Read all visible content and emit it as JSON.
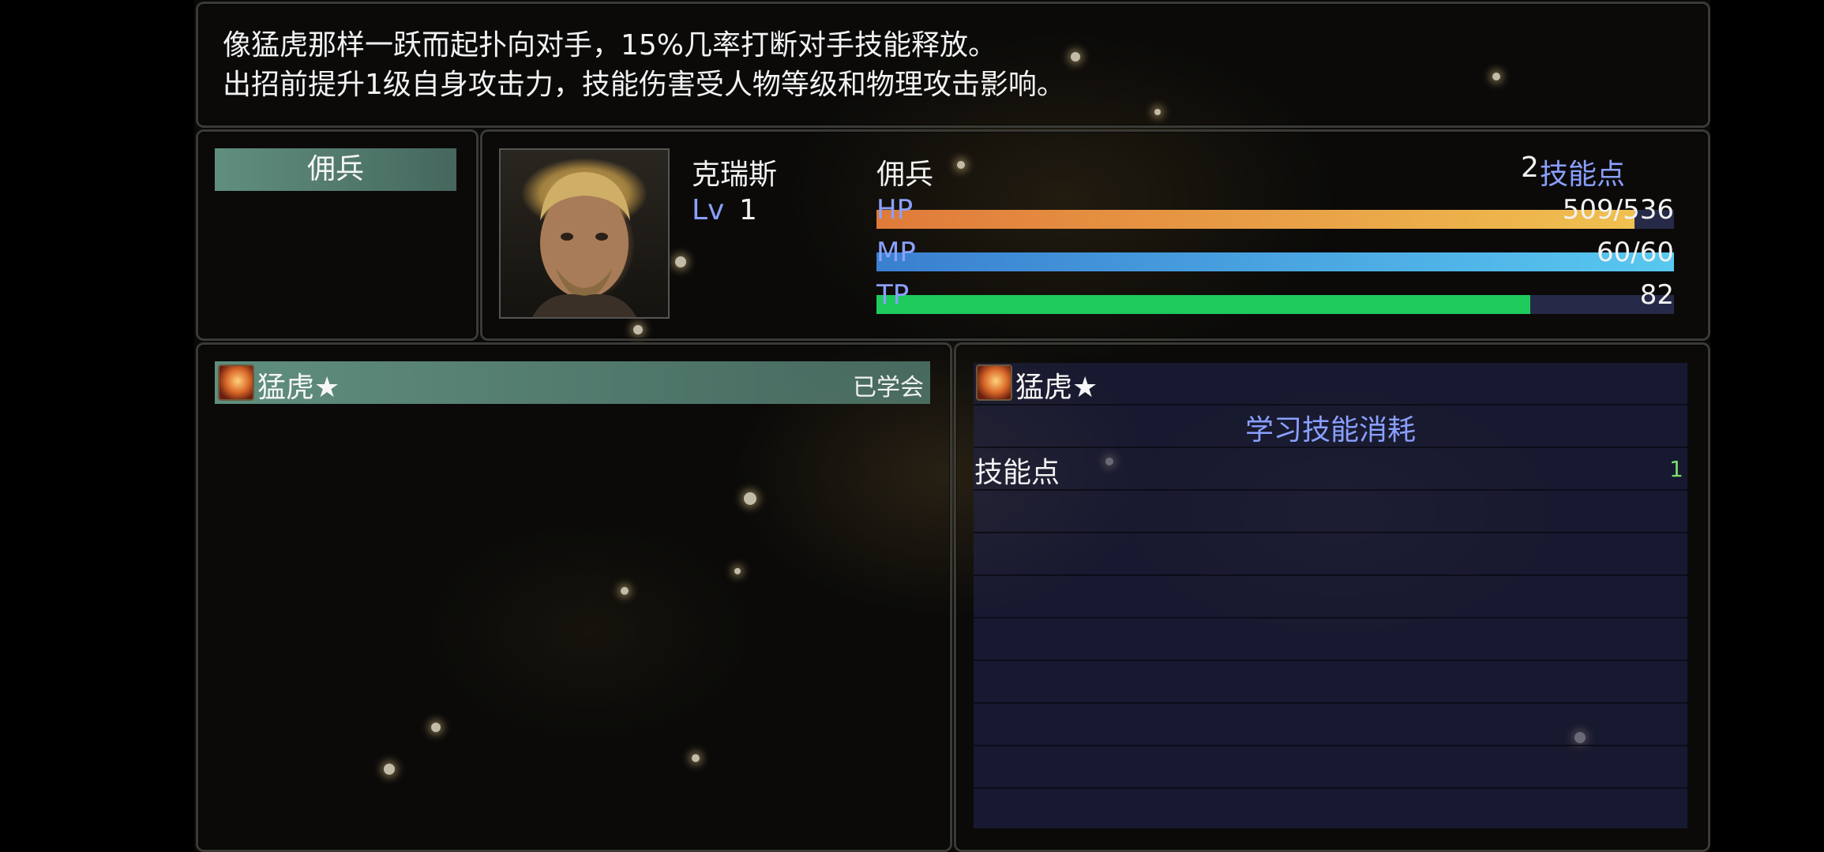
{
  "description": {
    "line1": "像猛虎那样一跃而起扑向对手，15%几率打断对手技能释放。",
    "line2": "出招前提升1级自身攻击力，技能伤害受人物等级和物理攻击影响。"
  },
  "class_list": {
    "selected": "佣兵"
  },
  "actor": {
    "name": "克瑞斯",
    "level_label": "Lv",
    "level": "1",
    "class_name": "佣兵",
    "skill_points_count": "2",
    "skill_points_label": "技能点",
    "hp_label": "HP",
    "hp_value": "509/536",
    "hp_fraction": 0.95,
    "mp_label": "MP",
    "mp_value": "60/60",
    "mp_fraction": 1.0,
    "tp_label": "TP",
    "tp_value": "82",
    "tp_fraction": 0.82
  },
  "skill_list": {
    "items": [
      {
        "name": "猛虎★",
        "status": "已学会",
        "icon": "tiger-skill-icon"
      }
    ]
  },
  "cost_panel": {
    "skill_name": "猛虎★",
    "header": "学习技能消耗",
    "rows": [
      {
        "label": "技能点",
        "value": "1"
      }
    ]
  },
  "colors": {
    "hp_gradient": [
      "#e07a3a",
      "#f0c050"
    ],
    "mp_gradient": [
      "#3a7fd0",
      "#58c8f0"
    ],
    "tp": "#1ecb5c",
    "accent_blue": "#8aa0ff",
    "teal_highlight": "#78b4a0"
  }
}
